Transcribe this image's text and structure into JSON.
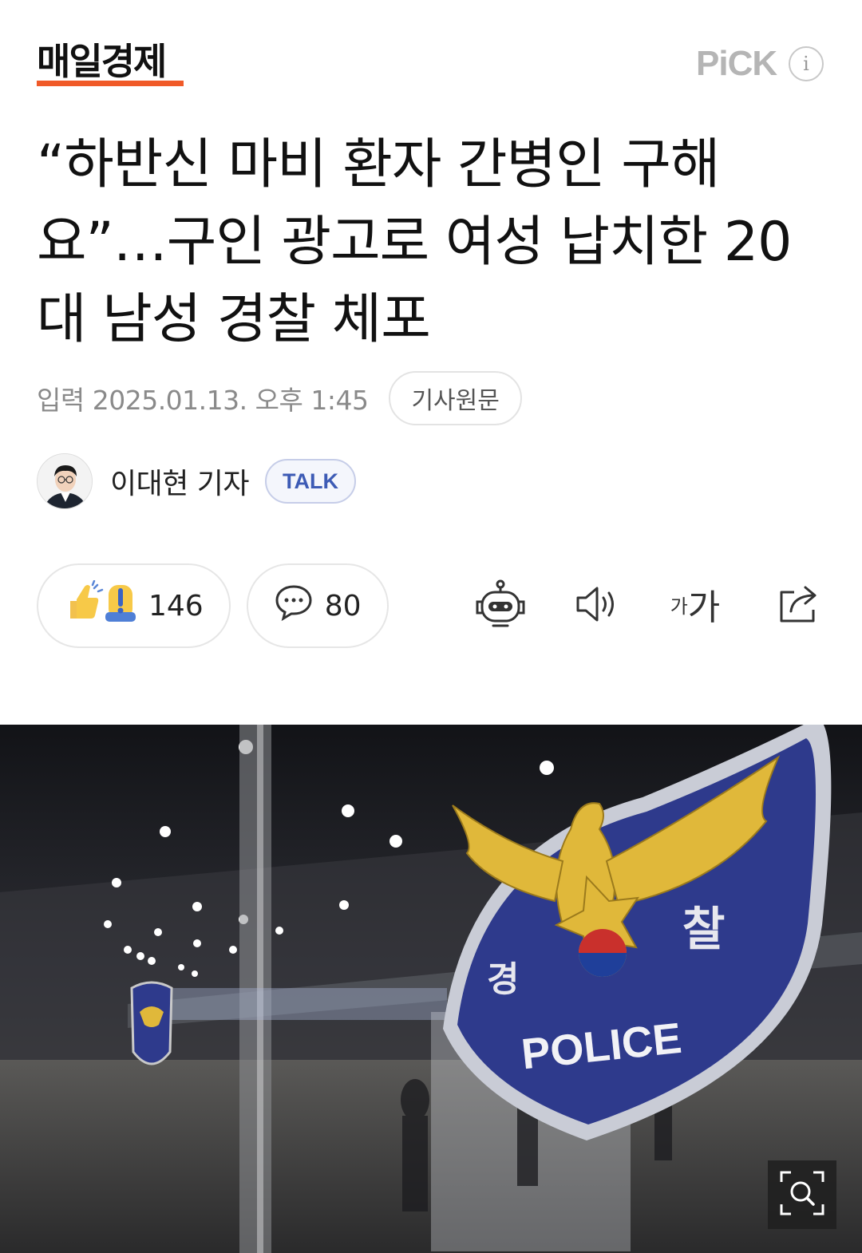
{
  "header": {
    "logo": "매일경제",
    "pick_label": "PiCK",
    "info_label": "i"
  },
  "article": {
    "title": "“하반신 마비 환자 간병인 구해요”…구인 광고로 여성 납치한 20대 남성 경찰 체포",
    "date": "입력 2025.01.13. 오후 1:45",
    "origin_button": "기사원문",
    "reporter_name": "이대현 기자",
    "talk_label": "TALK"
  },
  "reactions": {
    "like_count": "146",
    "comment_count": "80"
  },
  "toolbar": {
    "font_small": "가",
    "font_large": "가"
  },
  "photo": {
    "badge_left_text": "경",
    "badge_right_text": "찰",
    "badge_text": "POLICE"
  },
  "colors": {
    "logo_underline": "#f05a28",
    "talk_accent": "#3d5bb5",
    "badge_blue": "#2e3a8c",
    "badge_gold": "#e0b83a"
  }
}
